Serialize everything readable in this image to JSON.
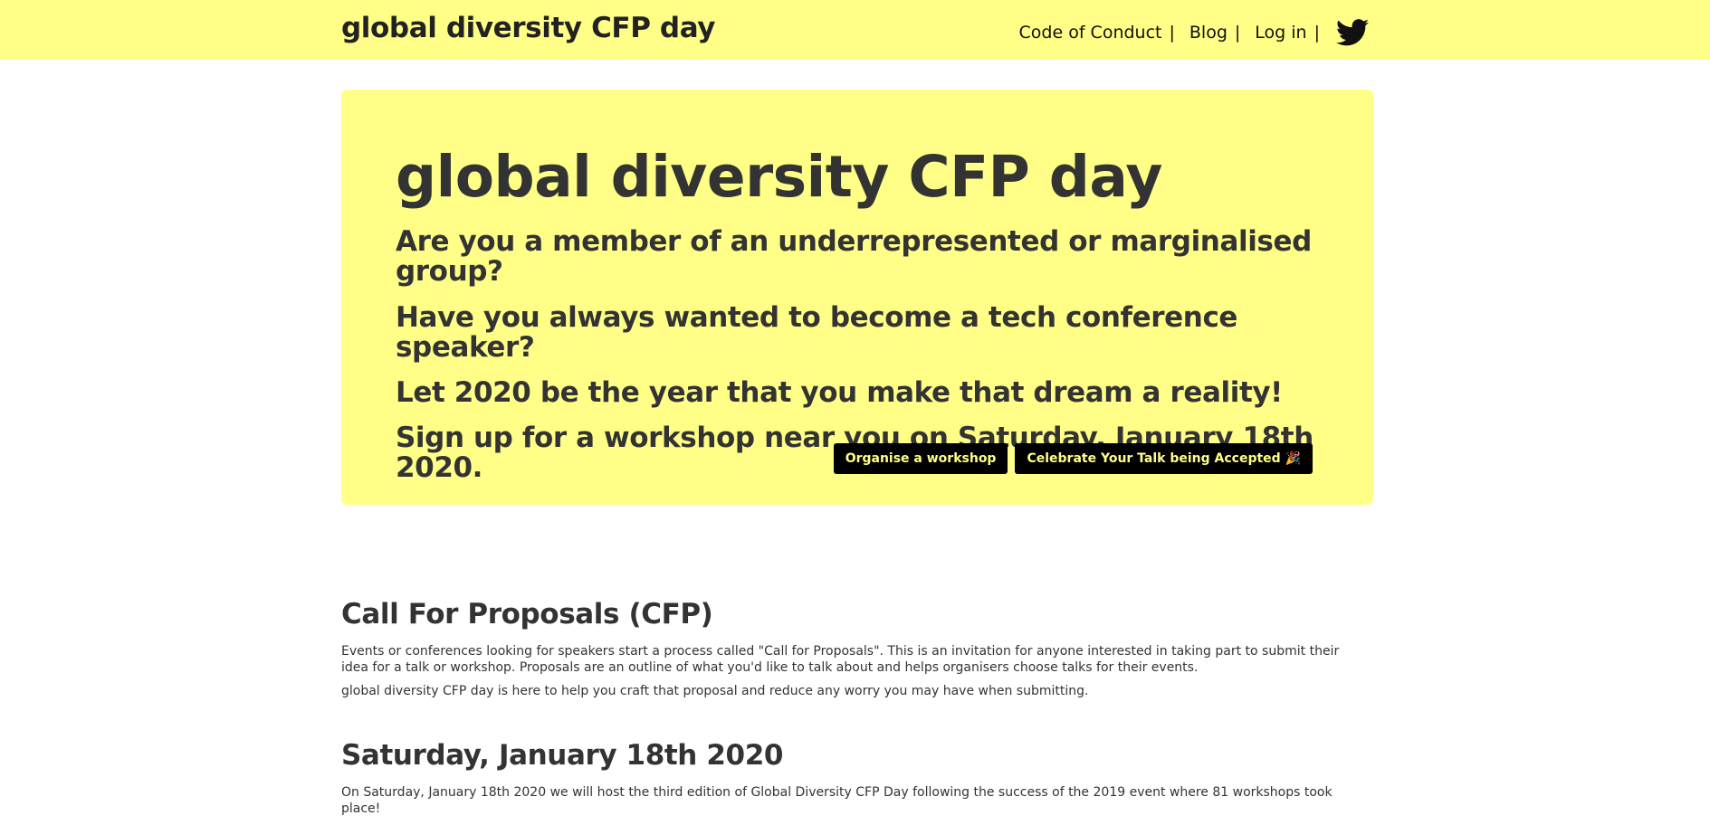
{
  "nav": {
    "brand": "global diversity CFP day",
    "links": [
      "Code of Conduct",
      "Blog",
      "Log in"
    ],
    "separator": "|",
    "social_icon": "twitter-icon"
  },
  "hero": {
    "title": "global diversity CFP day",
    "lines": [
      "Are you a member of an underrepresented or marginalised group?",
      "Have you always wanted to become a tech conference speaker?",
      "Let 2020 be the year that you make that dream a reality!",
      "Sign up for a workshop near you on Saturday, January 18th 2020."
    ],
    "buttons": [
      "Organise a workshop",
      "Celebrate Your Talk being Accepted 🎉"
    ]
  },
  "sections": [
    {
      "title": "Call For Proposals (CFP)",
      "paragraphs": [
        "Events or conferences looking for speakers start a process called \"Call for Proposals\". This is an invitation for anyone interested in taking part to submit their idea for a talk or workshop. Proposals are an outline of what you'd like to talk about and helps organisers choose talks for their events.",
        "global diversity CFP day is here to help you craft that proposal and reduce any worry you may have when submitting."
      ]
    },
    {
      "title": "Saturday, January 18th 2020",
      "paragraphs": [
        "On Saturday, January 18th 2020 we will host the third edition of Global Diversity CFP Day following the success of the 2019 event where 81 workshops took place!"
      ]
    }
  ],
  "colors": {
    "brand_yellow": "#ffff88",
    "text_dark": "#333333",
    "button_bg": "#000000"
  }
}
